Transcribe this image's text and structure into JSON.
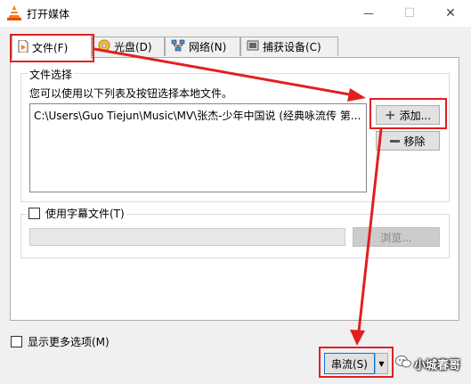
{
  "window": {
    "title": "打开媒体"
  },
  "titlebar": {
    "minimize": "—",
    "maximize": "☐",
    "close": "✕"
  },
  "tabs": [
    {
      "label": "文件(F)"
    },
    {
      "label": "光盘(D)"
    },
    {
      "label": "网络(N)"
    },
    {
      "label": "捕获设备(C)"
    }
  ],
  "file_selection": {
    "legend": "文件选择",
    "hint": "您可以使用以下列表及按钮选择本地文件。",
    "files": [
      "C:\\Users\\Guo Tiejun\\Music\\MV\\张杰-少年中国说 (经典咏流传 第..."
    ],
    "add_label": "添加...",
    "remove_label": "移除"
  },
  "subtitle": {
    "checkbox_label": "使用字幕文件(T)",
    "path_value": "",
    "browse_label": "浏览..."
  },
  "show_more_label": "显示更多选项(M)",
  "stream_label": "串流(S)",
  "watermark": "小城春哥",
  "colors": {
    "annotation": "#e02020",
    "selection": "#0078d7"
  }
}
